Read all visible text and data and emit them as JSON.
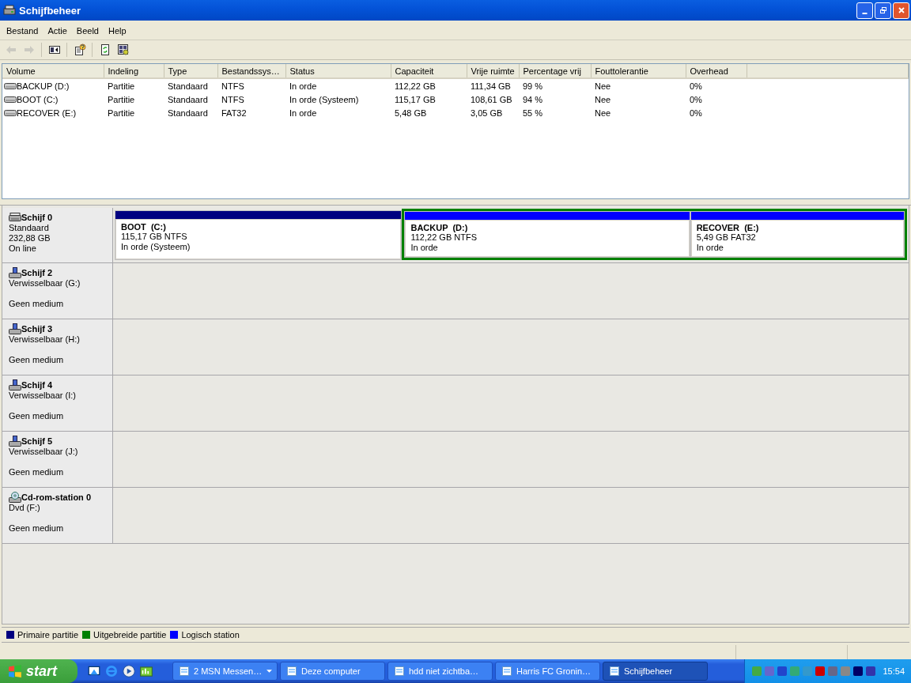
{
  "window": {
    "title": "Schijfbeheer"
  },
  "menu": [
    "Bestand",
    "Actie",
    "Beeld",
    "Help"
  ],
  "toolbar": [
    {
      "kind": "back",
      "disabled": true
    },
    {
      "kind": "forward",
      "disabled": true
    },
    {
      "kind": "sep"
    },
    {
      "kind": "panel",
      "disabled": false
    },
    {
      "kind": "sep"
    },
    {
      "kind": "help",
      "disabled": false
    },
    {
      "kind": "sep"
    },
    {
      "kind": "refresh",
      "disabled": false
    },
    {
      "kind": "props",
      "disabled": false
    }
  ],
  "volume_list": {
    "columns": [
      "Volume",
      "Indeling",
      "Type",
      "Bestandssys…",
      "Status",
      "Capaciteit",
      "Vrije ruimte",
      "Percentage vrij",
      "Fouttolerantie",
      "Overhead"
    ],
    "rows": [
      [
        "BACKUP (D:)",
        "Partitie",
        "Standaard",
        "NTFS",
        "In orde",
        "112,22 GB",
        "111,34 GB",
        "99 %",
        "Nee",
        "0%"
      ],
      [
        "BOOT (C:)",
        "Partitie",
        "Standaard",
        "NTFS",
        "In orde (Systeem)",
        "115,17 GB",
        "108,61 GB",
        "94 %",
        "Nee",
        "0%"
      ],
      [
        "RECOVER (E:)",
        "Partitie",
        "Standaard",
        "FAT32",
        "In orde",
        "5,48 GB",
        "3,05 GB",
        "55 %",
        "Nee",
        "0%"
      ]
    ]
  },
  "disks": [
    {
      "kind": "hdd",
      "name": "Schijf 0",
      "type": "Standaard",
      "size": "232,88 GB",
      "status": "On line",
      "partitions": [
        {
          "kind": "primary",
          "color": "#000080",
          "name": "BOOT  (C:)",
          "size": "115,17 GB NTFS",
          "status": "In orde (Systeem)"
        },
        {
          "kind": "extended",
          "color": "#008000",
          "children": [
            {
              "kind": "logical",
              "color": "#0000ff",
              "name": "BACKUP  (D:)",
              "size": "112,22 GB NTFS",
              "status": "In orde"
            },
            {
              "kind": "logical",
              "color": "#0000ff",
              "name": "RECOVER  (E:)",
              "size": "5,49 GB FAT32",
              "status": "In orde"
            }
          ]
        }
      ]
    },
    {
      "kind": "removable",
      "name": "Schijf 2",
      "type": "Verwisselbaar (G:)",
      "status": "Geen medium"
    },
    {
      "kind": "removable",
      "name": "Schijf 3",
      "type": "Verwisselbaar (H:)",
      "status": "Geen medium"
    },
    {
      "kind": "removable",
      "name": "Schijf 4",
      "type": "Verwisselbaar (I:)",
      "status": "Geen medium"
    },
    {
      "kind": "removable",
      "name": "Schijf 5",
      "type": "Verwisselbaar (J:)",
      "status": "Geen medium"
    },
    {
      "kind": "cdrom",
      "name": "Cd-rom-station 0",
      "type": "Dvd (F:)",
      "status": "Geen medium"
    }
  ],
  "legend": [
    {
      "label": "Primaire partitie",
      "color": "#000080"
    },
    {
      "label": "Uitgebreide partitie",
      "color": "#008000"
    },
    {
      "label": "Logisch station",
      "color": "#0000ff"
    }
  ],
  "taskbar": {
    "start": "start",
    "tasks": [
      {
        "label": "2 MSN Messen…",
        "selected": false,
        "dropdown": true
      },
      {
        "label": "Deze computer",
        "selected": false,
        "dropdown": false
      },
      {
        "label": "hdd niet zichtba…",
        "selected": false,
        "dropdown": false
      },
      {
        "label": "Harris FC Gronin…",
        "selected": false,
        "dropdown": false
      },
      {
        "label": "Schijfbeheer",
        "selected": true,
        "dropdown": false
      }
    ],
    "clock": "15:54"
  }
}
